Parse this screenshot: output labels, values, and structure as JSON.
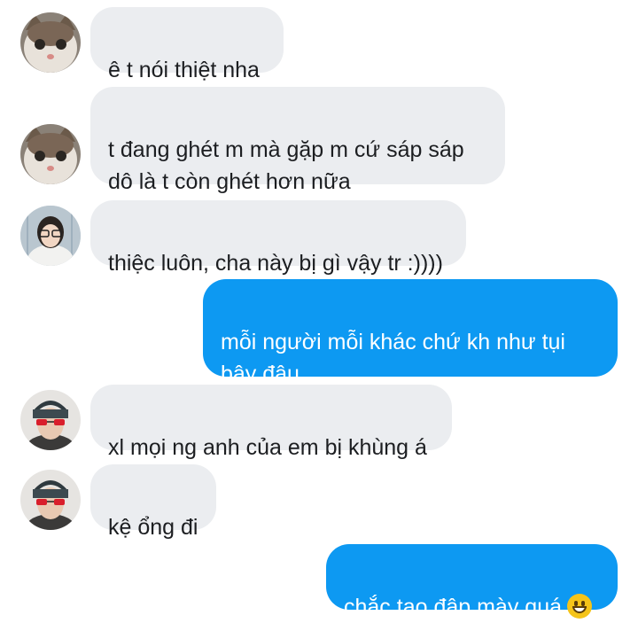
{
  "messages": [
    {
      "sender": "cat",
      "direction": "incoming",
      "text": "ê t nói thiệt nha"
    },
    {
      "sender": "cat",
      "direction": "incoming",
      "text": "t đang ghét m mà gặp m cứ sáp sáp\ndô là t còn ghét hơn nữa"
    },
    {
      "sender": "girl",
      "direction": "incoming",
      "text": "thiệc luôn, cha này bị gì vậy tr :))))"
    },
    {
      "sender": "me",
      "direction": "outgoing",
      "text": "mỗi người mỗi khác chứ kh như tụi\nbây đâu"
    },
    {
      "sender": "guy",
      "direction": "incoming",
      "text": "xl mọi ng anh của em bị khùng á"
    },
    {
      "sender": "guy",
      "direction": "incoming",
      "text": "kệ ổng đi"
    },
    {
      "sender": "me",
      "direction": "outgoing",
      "text": "chắc tao đập mày quá",
      "emoji": "grinning-face-emoji"
    }
  ],
  "colors": {
    "incoming_bubble": "#ebedf0",
    "outgoing_bubble": "#0d99f2",
    "incoming_text": "#1c1e21",
    "outgoing_text": "#ffffff"
  }
}
